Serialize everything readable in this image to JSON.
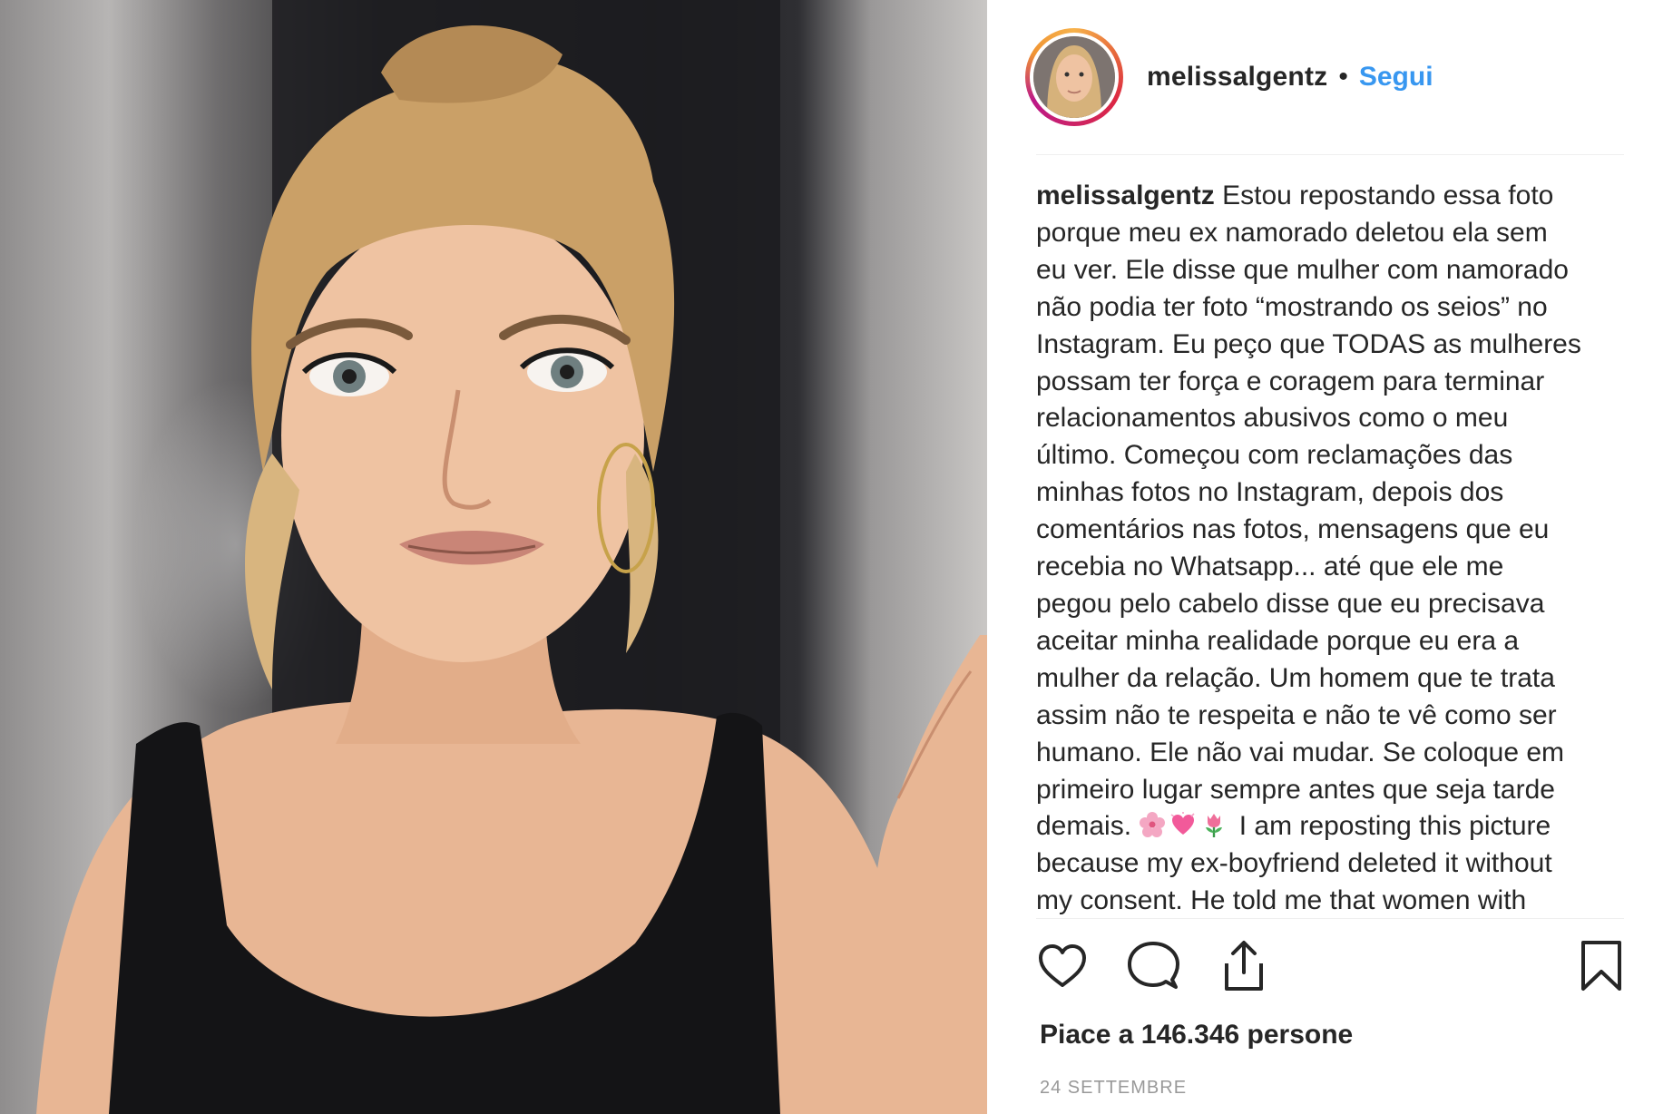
{
  "post": {
    "username": "melissalgentz",
    "separator": "•",
    "follow_label": "Segui",
    "caption": {
      "username": "melissalgentz",
      "lines": [
        "Estou repostando essa foto",
        "porque meu ex namorado deletou ela sem",
        "eu ver. Ele disse que mulher com namorado",
        "não podia ter foto “mostrando os seios” no",
        "Instagram. Eu peço que TODAS as mulheres",
        "possam ter força e coragem para terminar",
        "relacionamentos abusivos como o meu",
        "último. Começou com reclamações das",
        "minhas fotos no Instagram, depois dos",
        "comentários nas fotos, mensagens que eu",
        "recebia no Whatsapp... até que ele me",
        "pegou pelo cabelo disse que eu precisava",
        "aceitar minha realidade porque eu era a",
        "mulher da relação. Um homem que te trata",
        "assim não te respeita e não te vê como ser",
        "humano. Ele não vai mudar. Se coloque em",
        "primeiro lugar sempre antes que seja tarde",
        "demais.",
        "I am reposting this picture",
        "because my ex-boyfriend deleted it without",
        "my consent. He told me that women with"
      ],
      "emojis": [
        "cherry-blossom",
        "heart-sparkle",
        "tulip"
      ]
    },
    "actions": {
      "like_icon": "heart-icon",
      "comment_icon": "comment-icon",
      "share_icon": "share-icon",
      "save_icon": "bookmark-icon"
    },
    "likes_text": "Piace a 146.346 persone",
    "date": "24 SETTEMBRE"
  },
  "colors": {
    "text": "#262626",
    "link": "#3897f0",
    "muted": "#999999",
    "divider": "#efefef"
  }
}
